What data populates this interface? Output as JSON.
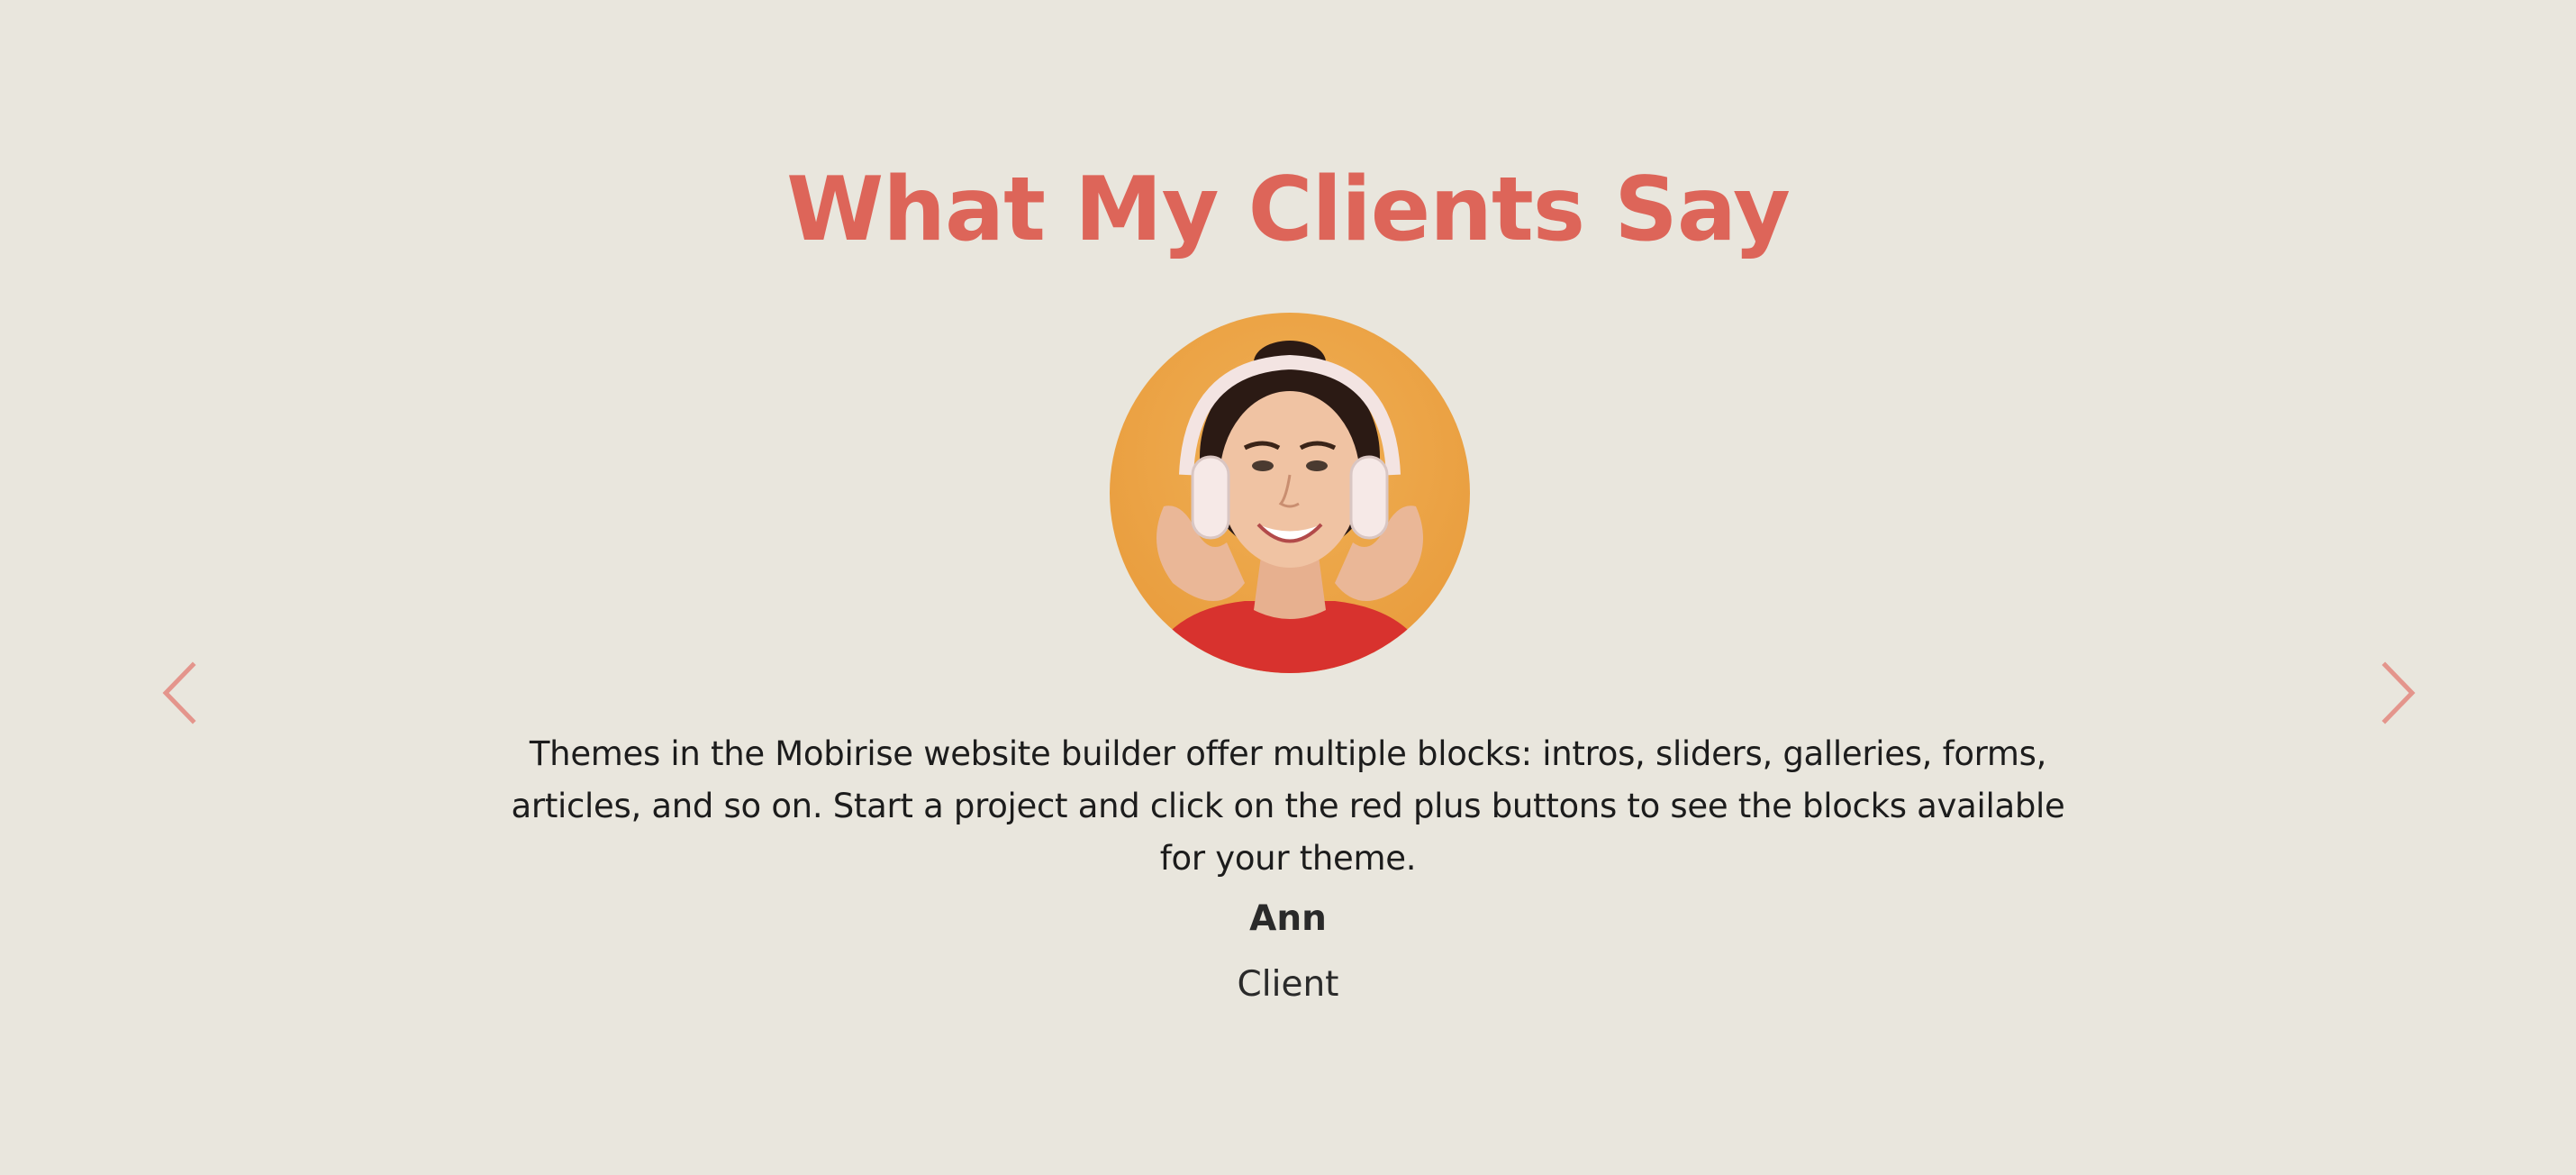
{
  "section": {
    "title": "What My Clients Say",
    "accent_color": "#dd6559",
    "background_color": "#e9e6dd"
  },
  "testimonial": {
    "avatar_icon": "client-portrait-with-headphones",
    "quote": "Themes in the Mobirise website builder offer multiple blocks: intros, sliders, galleries, forms, articles, and so on. Start a project and click on the red plus buttons to see the blocks available for your theme.",
    "author_name": "Ann",
    "author_role": "Client"
  },
  "controls": {
    "prev_icon": "chevron-left-icon",
    "next_icon": "chevron-right-icon",
    "arrow_color": "#e4958c"
  }
}
